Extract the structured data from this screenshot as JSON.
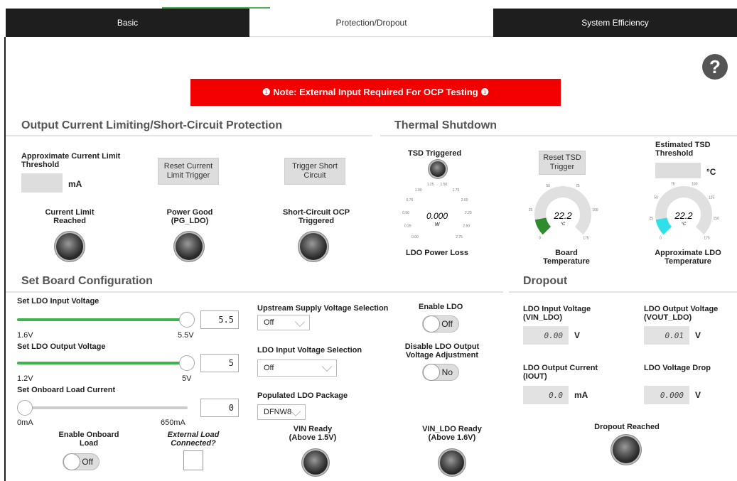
{
  "tabs": [
    {
      "label": "Basic",
      "active": false
    },
    {
      "label": "Protection/Dropout",
      "active": true
    },
    {
      "label": "System Efficiency",
      "active": false
    }
  ],
  "help": {
    "glyph": "?"
  },
  "note": "❶ Note: External Input Required For OCP Testing ❶",
  "ocp": {
    "title": "Output Current Limiting/Short-Circuit Protection",
    "threshold_label": "Approximate Current Limit Threshold",
    "threshold_unit": "mA",
    "reset_button": "Reset Current Limit Trigger",
    "trigger_button": "Trigger Short Circuit",
    "current_limit_led": "Current Limit Reached",
    "power_good_led": "Power Good (PG_LDO)",
    "ocp_led": "Short-Circuit OCP Triggered"
  },
  "thermal": {
    "title": "Thermal Shutdown",
    "tsd_label": "TSD Triggered",
    "reset_button": "Reset TSD Trigger",
    "estimated_label": "Estimated TSD Threshold",
    "estimated_unit": "°C",
    "power_gauge": {
      "label": "LDO Power Loss",
      "value": "0.000",
      "unit": "W",
      "level": 0,
      "ticks": [
        "0.00",
        "0.25",
        "0.50",
        "0.75",
        "1.00",
        "1.25",
        "1.50",
        "1.75",
        "2.00",
        "2.25",
        "2.50",
        "2.75"
      ]
    },
    "board_gauge": {
      "label": "Board Temperature",
      "value": "22.2",
      "unit": "°C",
      "level": 0.127,
      "ticks": [
        "0",
        "25",
        "50",
        "75",
        "100",
        "175"
      ]
    },
    "ldo_gauge": {
      "label": "Approximate LDO Temperature",
      "value": "22.2",
      "unit": "°C",
      "level": 0.127,
      "ticks": [
        "0",
        "25",
        "50",
        "75",
        "100",
        "125",
        "150",
        "175"
      ]
    }
  },
  "board": {
    "title": "Set Board Configuration",
    "vin": {
      "label": "Set LDO Input Voltage",
      "value": "5.5",
      "min": "1.6V",
      "max": "5.5V",
      "level": 1
    },
    "vout": {
      "label": "Set LDO Output Voltage",
      "value": "5",
      "min": "1.2V",
      "max": "5V",
      "level": 1
    },
    "load": {
      "label": "Set Onboard Load Current",
      "value": "0",
      "min": "0mA",
      "max": "650mA",
      "level": 0
    },
    "upstream_label": "Upstream Supply Voltage Selection",
    "upstream_value": "Off",
    "input_sel_label": "LDO Input Voltage Selection",
    "input_sel_value": "Off",
    "package_label": "Populated LDO Package",
    "package_value": "DFNW8",
    "enable_ldo_label": "Enable LDO",
    "enable_ldo_value": "Off",
    "disable_adj_label": "Disable LDO Output Voltage Adjustment",
    "disable_adj_value": "No",
    "enable_load_label": "Enable Onboard Load",
    "enable_load_value": "Off",
    "external_load_label": "External Load Connected?",
    "vin_ready_label": "VIN Ready (Above 1.5V)",
    "vinldo_ready_label": "VIN_LDO Ready (Above 1.6V)"
  },
  "dropout": {
    "title": "Dropout",
    "vin_label": "LDO Input Voltage (VIN_LDO)",
    "vin_value": "0.00",
    "vin_unit": "V",
    "vout_label": "LDO Output Voltage (VOUT_LDO)",
    "vout_value": "0.01",
    "vout_unit": "V",
    "iout_label": "LDO Output Current (IOUT)",
    "iout_value": "0.0",
    "iout_unit": "mA",
    "drop_label": "LDO Voltage Drop",
    "drop_value": "0.000",
    "drop_unit": "V",
    "reached_label": "Dropout Reached"
  },
  "colors": {
    "note_bg": "#f20000",
    "slider_fill": "#3bb54a",
    "board_gauge": "#2e8b2e",
    "ldo_gauge": "#2fe0e8",
    "tab_dark": "#1e1e1e"
  }
}
